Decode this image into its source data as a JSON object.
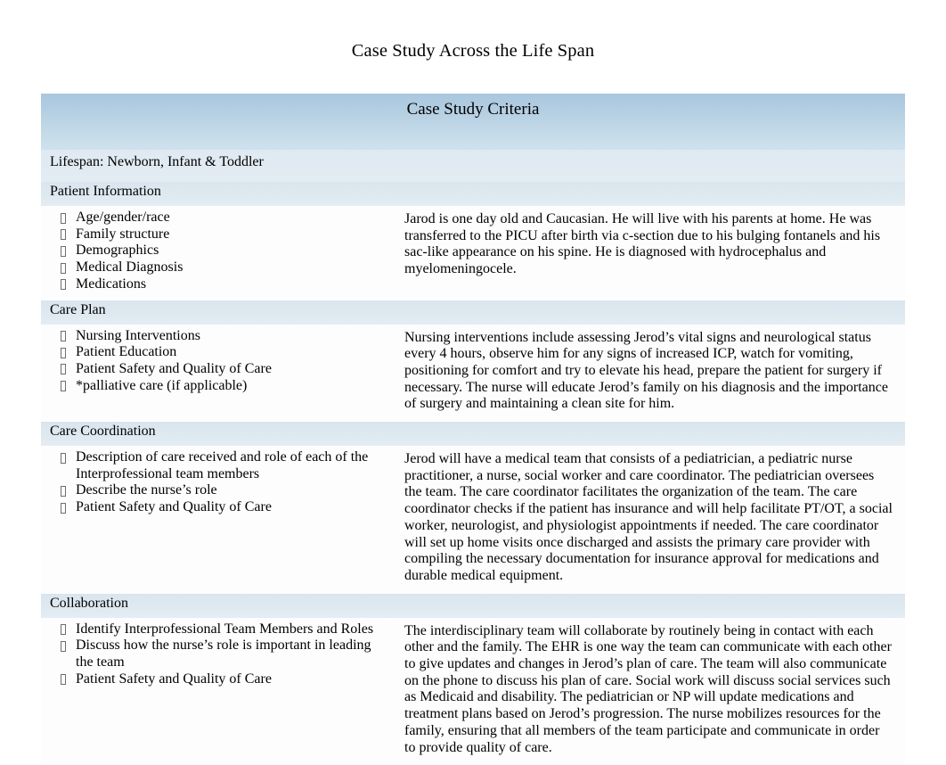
{
  "document": {
    "title": "Case Study Across the Life Span"
  },
  "table": {
    "header": "Case Study Criteria",
    "lifespan": "Lifespan: Newborn, Infant & Toddler",
    "sections": [
      {
        "heading": "Patient  Information",
        "criteria": [
          "Age/gender/race",
          "Family structure",
          "Demographics",
          "Medical  Diagnosis",
          "Medications"
        ],
        "response": "Jarod is one day old and Caucasian. He will live with his parents at home. He was transferred to the PICU after birth via c-section due to his bulging fontanels and his sac-like appearance on his spine. He is diagnosed with hydrocephalus and myelomeningocele."
      },
      {
        "heading": "Care  Plan",
        "criteria": [
          "Nursing Interventions",
          "Patient Education",
          "Patient Safety and Quality of Care",
          "*palliative care (if applicable)"
        ],
        "response": "Nursing interventions include assessing Jerod’s vital signs and neurological status every 4 hours, observe him for any signs of increased ICP, watch for vomiting, positioning for comfort and try to elevate his head, prepare the patient for surgery if necessary. The nurse will educate Jerod’s family on his diagnosis and the importance of surgery and maintaining a clean site for him."
      },
      {
        "heading": "Care  Coordination",
        "criteria": [
          "Description  of care received and role of each of the Interprofessional team members",
          "Describe the nurse’s role",
          "Patient Safety and Quality of Care"
        ],
        "response": "Jerod will have a medical team that consists of a pediatrician, a pediatric nurse practitioner, a nurse, social worker and care coordinator. The pediatrician oversees the team.  The care coordinator facilitates the organization of the team.  The care coordinator checks if the patient has insurance and will help facilitate PT/OT, a social worker, neurologist, and physiologist appointments if needed.  The care coordinator will set up home visits once discharged and assists the primary care provider with compiling the necessary documentation for insurance approval for medications and durable medical equipment."
      },
      {
        "heading": "Collaboration",
        "criteria": [
          "Identify Interprofessional Team Members and Roles",
          "Discuss how the nurse’s role is important in leading the team",
          "Patient Safety and Quality of Care"
        ],
        "response": "The interdisciplinary team will collaborate by routinely being in contact with each other and the family.  The EHR is one way the team can communicate with each other to give updates and changes in Jerod’s plan of care.  The team will also communicate on the phone to discuss his plan of care.  Social work will discuss social services such as Medicaid and disability. The pediatrician or NP will update medications and treatment plans based on Jerod’s progression.  The nurse mobilizes resources for the family, ensuring that all members of the team participate and communicate in order to provide quality of care."
      }
    ]
  },
  "colors": {
    "header_band_top": "#a8c6de",
    "header_band_bottom": "#cfe1ee",
    "section_band": "#dae5ee",
    "cell_background": "#fdfdfd",
    "text": "#000000"
  }
}
